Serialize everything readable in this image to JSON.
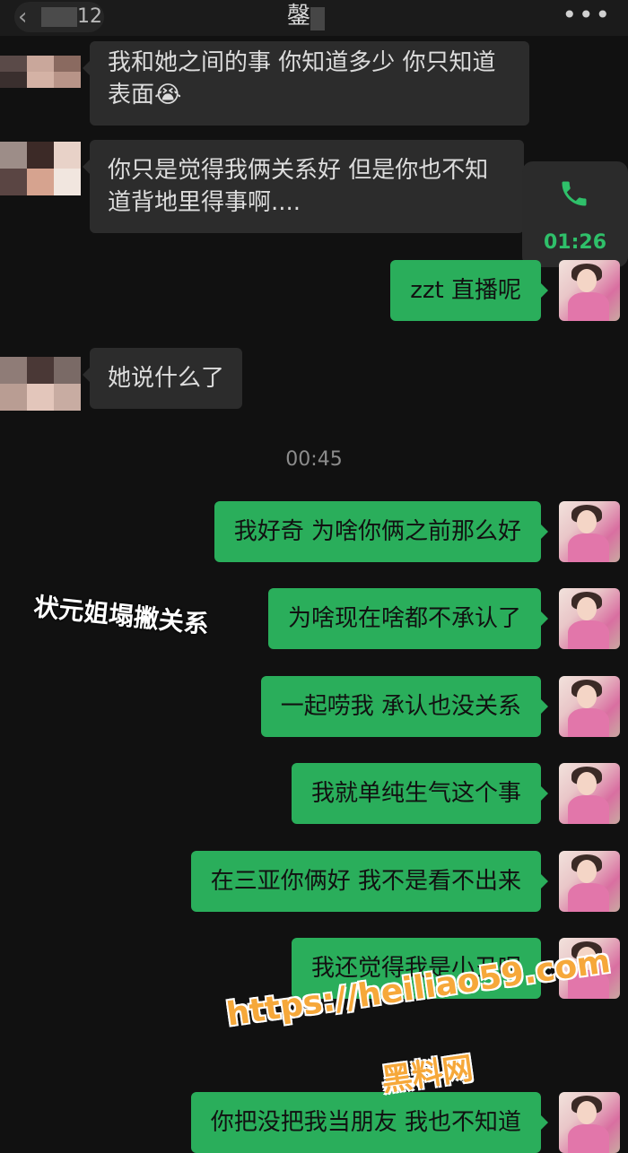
{
  "header": {
    "back_count": "12",
    "title": "鏧",
    "more_label": "•••",
    "back_icon": "chevron-left-icon"
  },
  "messages": [
    {
      "side": "left",
      "text": "我和她之间的事 你知道多少 你只知道表面😭"
    },
    {
      "side": "left",
      "text": "你只是觉得我俩关系好 但是你也不知道背地里得事啊...."
    },
    {
      "side": "right",
      "text": "zzt 直播呢"
    },
    {
      "side": "left",
      "text": "她说什么了"
    },
    {
      "side": "right",
      "text": "我好奇 为啥你俩之前那么好"
    },
    {
      "side": "right",
      "text": "为啥现在啥都不承认了"
    },
    {
      "side": "right",
      "text": "一起唠我 承认也没关系"
    },
    {
      "side": "right",
      "text": "我就单纯生气这个事"
    },
    {
      "side": "right",
      "text": "在三亚你俩好 我不是看不出来"
    },
    {
      "side": "right",
      "text": "我还觉得我是小丑呢"
    },
    {
      "side": "right",
      "text": "你把没把我当朋友 我也不知道"
    }
  ],
  "timestamps": [
    "00:45"
  ],
  "call": {
    "duration": "01:26",
    "icon": "phone-icon",
    "color": "#2fc06a"
  },
  "overlay_caption": "状元姐塌撇关系",
  "watermark": {
    "url": "https://heiliao59.com",
    "name": "黑料网",
    "color": "#f6a83a"
  },
  "colors": {
    "outgoing_bubble": "#2aae5b",
    "incoming_bubble": "#2c2c2c",
    "background": "#111111"
  }
}
